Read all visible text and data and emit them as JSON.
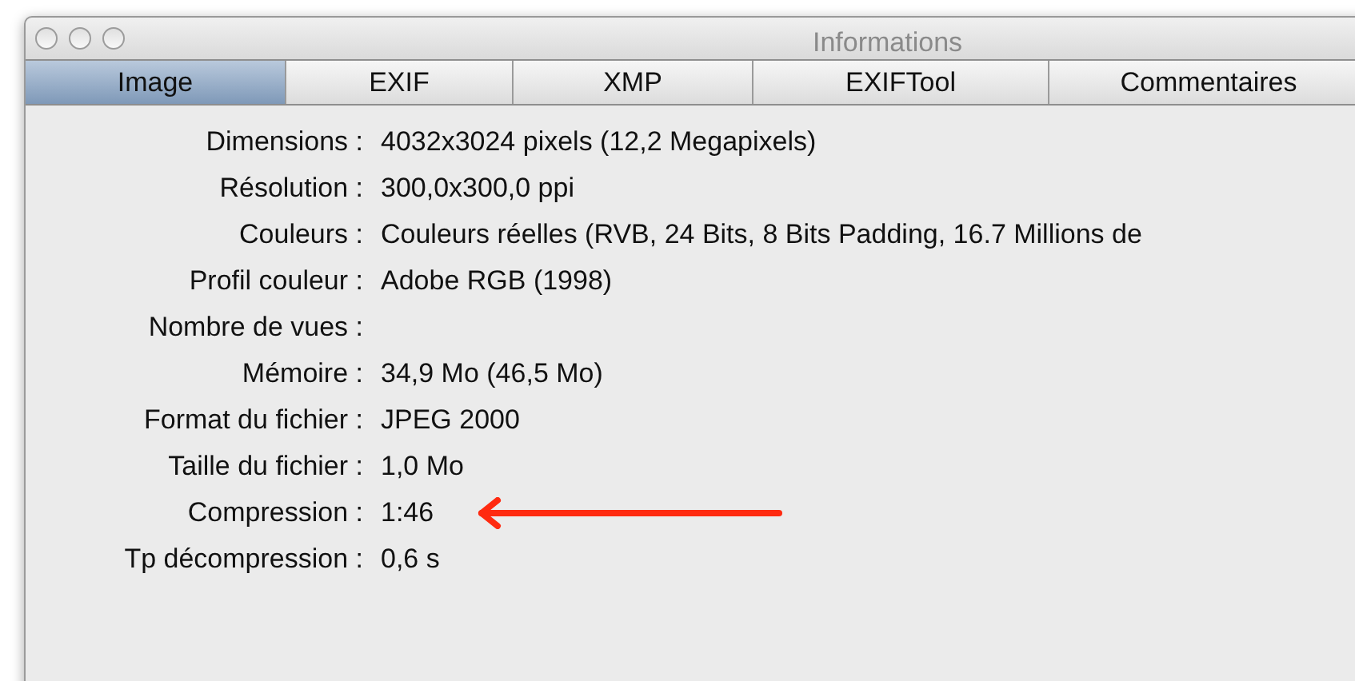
{
  "window": {
    "title": "Informations"
  },
  "tabs": [
    {
      "label": "Image",
      "selected": true
    },
    {
      "label": "EXIF",
      "selected": false
    },
    {
      "label": "XMP",
      "selected": false
    },
    {
      "label": "EXIFTool",
      "selected": false
    },
    {
      "label": "Commentaires",
      "selected": false
    }
  ],
  "rows": [
    {
      "label": "Dimensions :",
      "value": "4032x3024 pixels (12,2 Megapixels)",
      "highlighted": false
    },
    {
      "label": "Résolution :",
      "value": "300,0x300,0 ppi",
      "highlighted": false
    },
    {
      "label": "Couleurs :",
      "value": "Couleurs réelles (RVB, 24 Bits, 8 Bits Padding, 16.7 Millions de",
      "highlighted": false
    },
    {
      "label": "Profil couleur :",
      "value": "Adobe RGB (1998)",
      "highlighted": false
    },
    {
      "label": "Nombre de vues :",
      "highlighted": false
    },
    {
      "label": "Mémoire :",
      "value": "34,9 Mo (46,5 Mo)",
      "highlighted": false
    },
    {
      "label": "Format du fichier :",
      "value": "JPEG 2000",
      "highlighted": false
    },
    {
      "label": "Taille du fichier :",
      "value": "1,0 Mo",
      "highlighted": false
    },
    {
      "label": "Compression :",
      "value": "1:46",
      "highlighted": true
    },
    {
      "label": "Tp décompression :",
      "value": "0,6 s",
      "highlighted": false
    }
  ]
}
